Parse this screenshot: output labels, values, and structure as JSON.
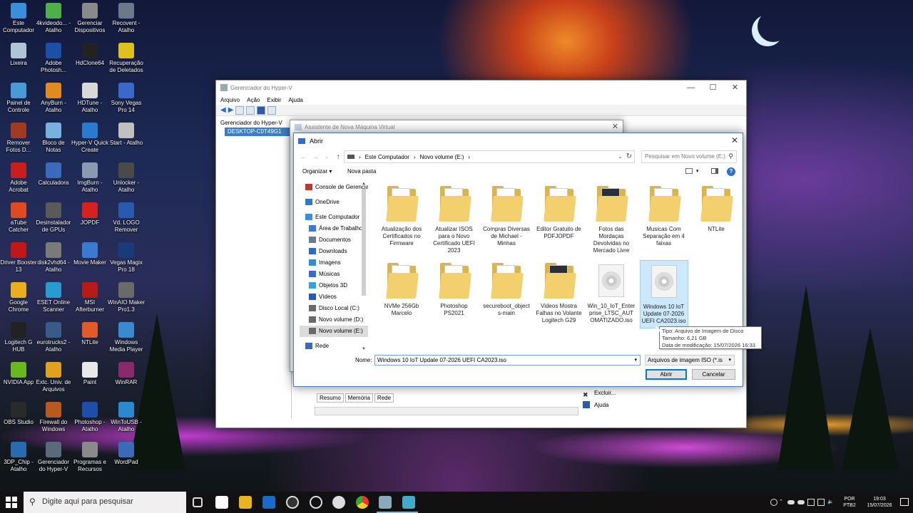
{
  "desktop": {
    "icons": [
      {
        "label": "Este Computador",
        "color": "#3a8fd8"
      },
      {
        "label": "4kvideodo... - Atalho",
        "color": "#4fb04a"
      },
      {
        "label": "Gerenciar Dispositivos",
        "color": "#8a8a8a"
      },
      {
        "label": "Recovent - Atalho",
        "color": "#6a7a8a"
      },
      {
        "label": "Lixeira",
        "color": "#b0c4d8"
      },
      {
        "label": "Adobe Photosh...",
        "color": "#1e4fa8"
      },
      {
        "label": "HdClone64",
        "color": "#222222"
      },
      {
        "label": "Recuperação de Deletados",
        "color": "#e0c020"
      },
      {
        "label": "Painel de Controle",
        "color": "#4a9ad8"
      },
      {
        "label": "AnyBurn - Atalho",
        "color": "#e08a20"
      },
      {
        "label": "HDTune - Atalho",
        "color": "#d8d8d8"
      },
      {
        "label": "Sony Vegas Pro 14",
        "color": "#3a6ac8"
      },
      {
        "label": "Remover Fotos D...",
        "color": "#a03a20"
      },
      {
        "label": "Bloco de Notas",
        "color": "#7ab0e0"
      },
      {
        "label": "Hyper-V Quick Create",
        "color": "#2a7ad0"
      },
      {
        "label": "Start - Atalho",
        "color": "#c0c0c0"
      },
      {
        "label": "Adobe Acrobat",
        "color": "#c81e1e"
      },
      {
        "label": "Calculadora",
        "color": "#3a6ab8"
      },
      {
        "label": "ImgBurn - Atalho",
        "color": "#8a9ab0"
      },
      {
        "label": "Unlocker - Atalho",
        "color": "#4a4a4a"
      },
      {
        "label": "aTube Catcher",
        "color": "#e04a20"
      },
      {
        "label": "Desinstalador de GPUs",
        "color": "#5a5a5a"
      },
      {
        "label": "JOPDF",
        "color": "#d82020"
      },
      {
        "label": "Vd. LOGO Remover",
        "color": "#2a5ab0"
      },
      {
        "label": "Driver Booster 13",
        "color": "#c01818"
      },
      {
        "label": "disk2vhd64 - Atalho",
        "color": "#7a7a7a"
      },
      {
        "label": "Movie Maker",
        "color": "#3a7ad0"
      },
      {
        "label": "Vegas Magix Pro 18",
        "color": "#1a3a7a"
      },
      {
        "label": "Google Chrome",
        "color": "#e8b020"
      },
      {
        "label": "ESET Online Scanner",
        "color": "#2a9ad0"
      },
      {
        "label": "MSI Afterburner",
        "color": "#b81a1a"
      },
      {
        "label": "WinAIO Maker Pro1.3",
        "color": "#6a6a6a"
      },
      {
        "label": "Logitech G HUB",
        "color": "#222222"
      },
      {
        "label": "eurotrucks2 - Atalho",
        "color": "#3a5a8a"
      },
      {
        "label": "NTLite",
        "color": "#e05a2a"
      },
      {
        "label": "Windows Media Player",
        "color": "#3a8ad0"
      },
      {
        "label": "NVIDIA App",
        "color": "#6ab820"
      },
      {
        "label": "Extc. Univ. de Arquivos",
        "color": "#e0a020"
      },
      {
        "label": "Paint",
        "color": "#e8e8e8"
      },
      {
        "label": "WinRAR",
        "color": "#8a2a6a"
      },
      {
        "label": "OBS Studio",
        "color": "#2a2a2a"
      },
      {
        "label": "Firewall do Windows",
        "color": "#b85a20"
      },
      {
        "label": "Photoshop - Atalho",
        "color": "#1e4fa8"
      },
      {
        "label": "WinToUSB - Atalho",
        "color": "#2a8ad0"
      },
      {
        "label": "3DP_Chip - Atalho",
        "color": "#2a6ab0"
      },
      {
        "label": "Gerenciador do Hyper-V",
        "color": "#5a6a7a"
      },
      {
        "label": "Programas e Recursos",
        "color": "#8a8a8a"
      },
      {
        "label": "WordPad",
        "color": "#3a6ab8"
      }
    ]
  },
  "hyperv": {
    "title": "Gerenciador do Hyper-V",
    "menu": [
      "Arquivo",
      "Ação",
      "Exibir",
      "Ajuda"
    ],
    "tree": [
      "Gerenciador do Hyper-V",
      "DESKTOP-C0T49G1"
    ],
    "bottom_tabs": [
      "Resumo",
      "Memória",
      "Rede"
    ],
    "actions": [
      {
        "label": "Excluir...",
        "icon": "delete-icon"
      },
      {
        "label": "Ajuda",
        "icon": "help-icon"
      }
    ]
  },
  "wizard": {
    "title": "Assistente de Nova Máquina Virtual"
  },
  "dialog": {
    "title": "Abrir",
    "breadcrumb": [
      "Este Computador",
      "Novo volume (E:)"
    ],
    "search_placeholder": "Pesquisar em Novo volume (E:)",
    "organize_label": "Organizar ▾",
    "new_folder_label": "Nova pasta",
    "nav_items": [
      {
        "label": "Console de Gerenciamento",
        "icon": "console-icon"
      },
      {
        "label": "OneDrive",
        "icon": "onedrive-icon"
      },
      {
        "label": "Este Computador",
        "icon": "computer-icon"
      },
      {
        "label": "Área de Trabalho",
        "icon": "desktop-icon"
      },
      {
        "label": "Documentos",
        "icon": "documents-icon"
      },
      {
        "label": "Downloads",
        "icon": "downloads-icon"
      },
      {
        "label": "Imagens",
        "icon": "pictures-icon"
      },
      {
        "label": "Músicas",
        "icon": "music-icon"
      },
      {
        "label": "Objetos 3D",
        "icon": "objects-3d-icon"
      },
      {
        "label": "Vídeos",
        "icon": "videos-icon"
      },
      {
        "label": "Disco Local (C:)",
        "icon": "drive-icon"
      },
      {
        "label": "Novo volume (D:)",
        "icon": "drive-icon"
      },
      {
        "label": "Novo volume (E:)",
        "icon": "drive-icon"
      },
      {
        "label": "Rede",
        "icon": "network-icon"
      }
    ],
    "files": [
      {
        "name": "Atualização dos Certificados no Firmware",
        "kind": "folder"
      },
      {
        "name": "Atualizar ISOS para o Novo Certificado UEFI 2023",
        "kind": "folder"
      },
      {
        "name": "Compras Diversas de Michael - Minhas",
        "kind": "folder"
      },
      {
        "name": "Editor Gratuito de PDFJOPDF",
        "kind": "folder"
      },
      {
        "name": "Fotos das Mordaças Devolvidas no Mercado Livre",
        "kind": "folder"
      },
      {
        "name": "Musicas Com Separação em 4 faixas",
        "kind": "folder"
      },
      {
        "name": "NTLite",
        "kind": "folder"
      },
      {
        "name": "NVMe 256Gb Marcelo",
        "kind": "folder"
      },
      {
        "name": "Photoshop PS2021",
        "kind": "folder"
      },
      {
        "name": "secureboot_objects-main",
        "kind": "folder"
      },
      {
        "name": "Videos Mostra Falhas no Volante Logitech G29",
        "kind": "folder"
      },
      {
        "name": "Win_10_IoT_Enterprise_LTSC_AUTOMATIZADO.iso",
        "kind": "iso"
      },
      {
        "name": "Windows 10 IoT Update 07-2026 UEFI CA2023.iso",
        "kind": "iso"
      }
    ],
    "tooltip": {
      "type": "Tipo: Arquivo de Imagem de Disco",
      "size": "Tamanho: 6,21 GB",
      "modified": "Data de modificação: 15/07/2026 16:33"
    },
    "filename_label": "Nome:",
    "filename_value": "Windows 10 IoT Update 07-2026  UEFI CA2023.iso",
    "filetype_value": "Arquivos de imagem ISO  (*.is",
    "open_label": "Abrir",
    "cancel_label": "Cancelar"
  },
  "taskbar": {
    "search_placeholder": "Digite aqui para pesquisar",
    "lang_1": "POR",
    "lang_2": "PTB2",
    "time": "19:03",
    "date": "15/07/2026"
  }
}
